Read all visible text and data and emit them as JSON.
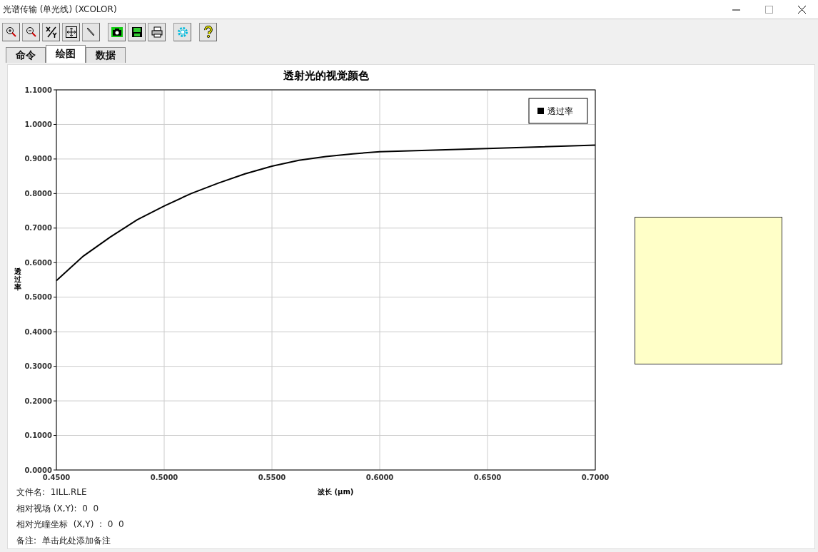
{
  "window": {
    "title": "光谱传输 (单光线) (XCOLOR)"
  },
  "tabs": [
    {
      "label": "命令",
      "selected": false
    },
    {
      "label": "绘图",
      "selected": true
    },
    {
      "label": "数据",
      "selected": false
    }
  ],
  "chart": {
    "chart_data": {
      "type": "line",
      "title": "透射光的视觉颜色",
      "xlabel": "波长 (µm)",
      "ylabel": "透过率",
      "x": [
        0.45,
        0.4625,
        0.475,
        0.4875,
        0.5,
        0.5125,
        0.525,
        0.5375,
        0.55,
        0.5625,
        0.575,
        0.5875,
        0.6,
        0.65,
        0.7
      ],
      "series": [
        {
          "name": "透过率",
          "color": "#000000",
          "values": [
            0.548,
            0.619,
            0.674,
            0.724,
            0.764,
            0.8,
            0.83,
            0.857,
            0.879,
            0.896,
            0.907,
            0.915,
            0.921,
            0.93,
            0.94
          ]
        }
      ],
      "grid": true,
      "xlim": [
        0.45,
        0.7
      ],
      "ylim": [
        0,
        1.1
      ],
      "xticks": [
        {
          "value": 0.45,
          "label": "0.4500"
        },
        {
          "value": 0.5,
          "label": "0.5000"
        },
        {
          "value": 0.55,
          "label": "0.5500"
        },
        {
          "value": 0.6,
          "label": "0.6000"
        },
        {
          "value": 0.65,
          "label": "0.6500"
        },
        {
          "value": 0.7,
          "label": "0.7000"
        }
      ],
      "yticks": [
        {
          "value": 0,
          "label": "0.0000"
        },
        {
          "value": 0.1,
          "label": "0.1000"
        },
        {
          "value": 0.2,
          "label": "0.2000"
        },
        {
          "value": 0.3,
          "label": "0.3000"
        },
        {
          "value": 0.4,
          "label": "0.4000"
        },
        {
          "value": 0.5,
          "label": "0.5000"
        },
        {
          "value": 0.6,
          "label": "0.6000"
        },
        {
          "value": 0.7,
          "label": "0.7000"
        },
        {
          "value": 0.8,
          "label": "0.8000"
        },
        {
          "value": 0.9,
          "label": "0.9000"
        },
        {
          "value": 1.0,
          "label": "1.0000"
        },
        {
          "value": 1.1,
          "label": "1.1000"
        }
      ]
    }
  },
  "info_lines": [
    "文件名:  1ILL.RLE",
    "相对视场 (X,Y):  0  0",
    "相对光瞳坐标  (X,Y)  :  0  0",
    "备注:  单击此处添加备注"
  ],
  "color_patch": {
    "color": "#ffffc8"
  }
}
